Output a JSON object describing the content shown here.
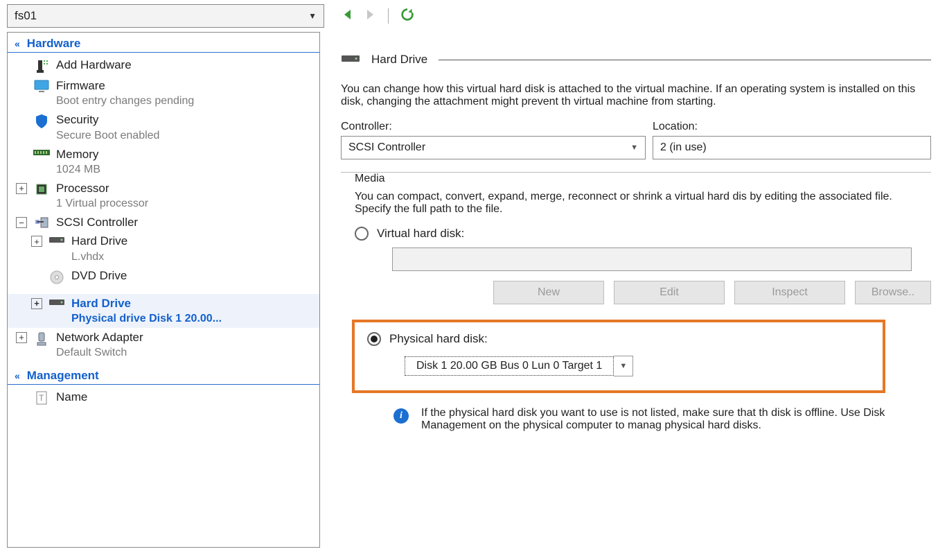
{
  "vm_dropdown": {
    "value": "fs01"
  },
  "sidebar": {
    "hardware_header": "Hardware",
    "management_header": "Management",
    "items": {
      "add_hardware": {
        "label": "Add Hardware"
      },
      "firmware": {
        "label": "Firmware",
        "sub": "Boot entry changes pending"
      },
      "security": {
        "label": "Security",
        "sub": "Secure Boot enabled"
      },
      "memory": {
        "label": "Memory",
        "sub": "1024 MB"
      },
      "processor": {
        "label": "Processor",
        "sub": "1 Virtual processor"
      },
      "scsi": {
        "label": "SCSI Controller"
      },
      "hard_drive_1": {
        "label": "Hard Drive",
        "sub": "L.vhdx"
      },
      "dvd": {
        "label": "DVD Drive"
      },
      "hard_drive_2": {
        "label": "Hard Drive",
        "sub": "Physical drive Disk 1 20.00..."
      },
      "network": {
        "label": "Network Adapter",
        "sub": "Default Switch"
      },
      "name": {
        "label": "Name"
      }
    }
  },
  "detail": {
    "title": "Hard Drive",
    "intro": "You can change how this virtual hard disk is attached to the virtual machine. If an operating system is installed on this disk, changing the attachment might prevent th virtual machine from starting.",
    "controller_label": "Controller:",
    "controller_value": "SCSI Controller",
    "location_label": "Location:",
    "location_value": "2 (in use)",
    "media_legend": "Media",
    "media_desc": "You can compact, convert, expand, merge, reconnect or shrink a virtual hard dis by editing the associated file. Specify the full path to the file.",
    "radio_vhd": "Virtual hard disk:",
    "radio_phys": "Physical hard disk:",
    "phys_value": "Disk 1 20.00 GB Bus 0 Lun 0 Target 1",
    "buttons": {
      "new": "New",
      "edit": "Edit",
      "inspect": "Inspect",
      "browse": "Browse.."
    },
    "info_text": "If the physical hard disk you want to use is not listed, make sure that th disk is offline. Use Disk Management on the physical computer to manag physical hard disks."
  }
}
